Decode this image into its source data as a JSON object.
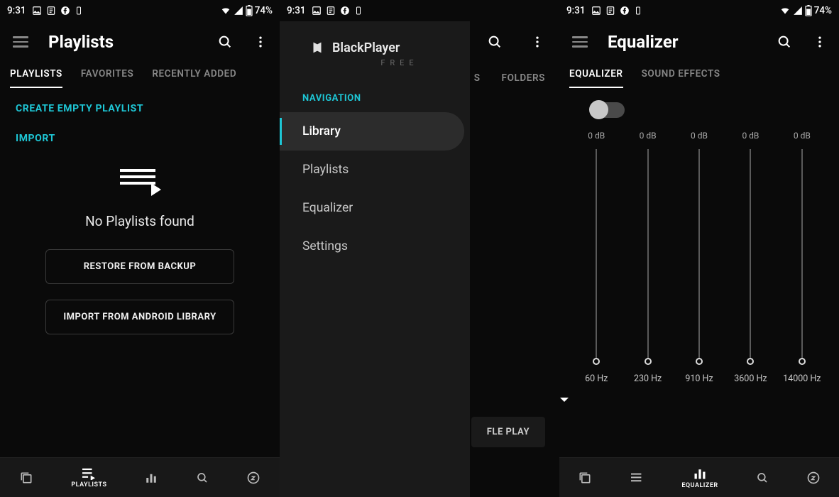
{
  "status": {
    "time": "9:31",
    "battery": "74%"
  },
  "screen1": {
    "title": "Playlists",
    "tabs": [
      "PLAYLISTS",
      "FAVORITES",
      "RECENTLY ADDED"
    ],
    "active_tab": 0,
    "create_link": "CREATE EMPTY PLAYLIST",
    "import_link": "IMPORT",
    "empty_text": "No Playlists found",
    "restore_btn": "RESTORE FROM BACKUP",
    "import_btn": "IMPORT FROM ANDROID LIBRARY",
    "bottom_label": "PLAYLISTS"
  },
  "screen2": {
    "brand": "BlackPlayer",
    "brand_sub": "FREE",
    "nav_header": "NAVIGATION",
    "nav_items": [
      "Library",
      "Playlists",
      "Equalizer",
      "Settings"
    ],
    "nav_selected": 0,
    "bd_tabs": [
      "S",
      "FOLDERS"
    ],
    "pill": "FLE PLAY"
  },
  "screen3": {
    "title": "Equalizer",
    "tabs": [
      "EQUALIZER",
      "SOUND EFFECTS"
    ],
    "active_tab": 0,
    "bands": [
      {
        "db": "0 dB",
        "hz": "60 Hz"
      },
      {
        "db": "0 dB",
        "hz": "230 Hz"
      },
      {
        "db": "0 dB",
        "hz": "910 Hz"
      },
      {
        "db": "0 dB",
        "hz": "3600 Hz"
      },
      {
        "db": "0 dB",
        "hz": "14000 Hz"
      }
    ],
    "bottom_label": "EQUALIZER"
  }
}
